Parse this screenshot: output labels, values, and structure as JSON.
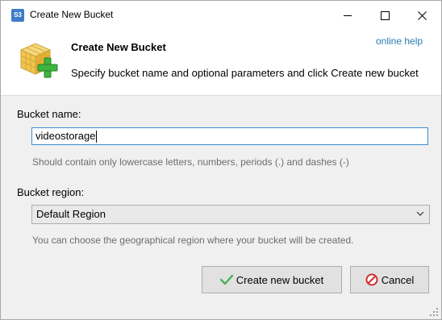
{
  "window": {
    "title": "Create New Bucket",
    "app_icon_text": "S3"
  },
  "header": {
    "title": "Create New Bucket",
    "description": "Specify bucket name and optional parameters and click Create new bucket",
    "help_link": "online help"
  },
  "form": {
    "name_label": "Bucket name:",
    "name_value": "videostorage",
    "name_hint": "Should contain only lowercase letters, numbers, periods (.) and dashes (-)",
    "region_label": "Bucket region:",
    "region_value": "Default Region",
    "region_hint": "You can choose the geographical region where your bucket will be created."
  },
  "buttons": {
    "create_label": "Create new bucket",
    "cancel_label": "Cancel"
  },
  "colors": {
    "accent": "#3c8ad1",
    "link": "#2a7ab0",
    "check_icon": "#4caf50",
    "cancel_icon": "#d32f2f"
  }
}
